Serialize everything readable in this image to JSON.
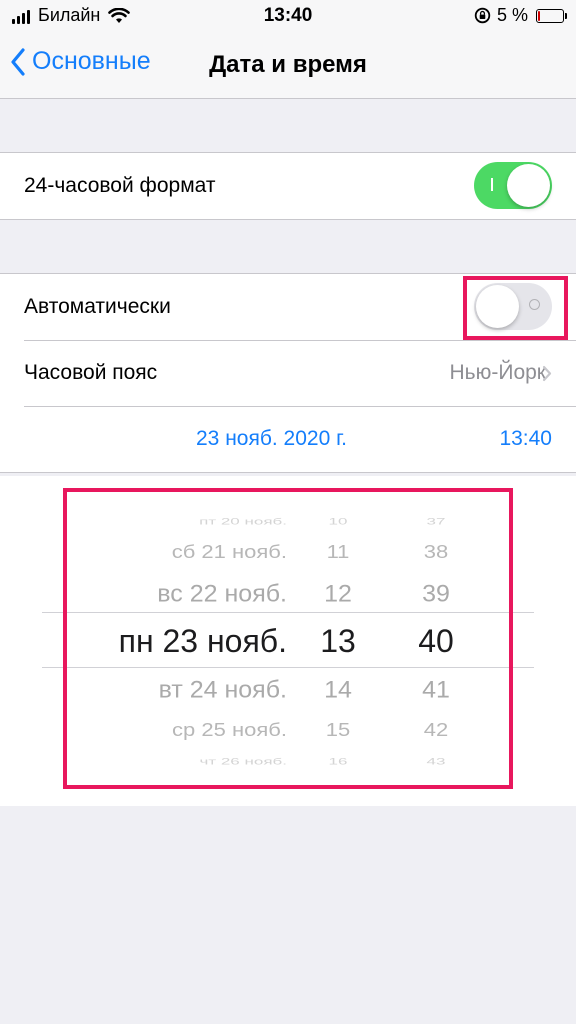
{
  "status_bar": {
    "carrier": "Билайн",
    "time": "13:40",
    "battery": "5 %"
  },
  "nav": {
    "back_label": "Основные",
    "title": "Дата и время"
  },
  "settings": {
    "format_24h": {
      "label": "24-часовой формат",
      "on": true
    },
    "automatic": {
      "label": "Автоматически",
      "on": false
    },
    "timezone": {
      "label": "Часовой пояс",
      "value": "Нью-Йорк"
    },
    "current_date": "23 нояб. 2020 г.",
    "current_time": "13:40"
  },
  "picker": {
    "dates": [
      "пт 20 нояб.",
      "сб 21 нояб.",
      "вс 22 нояб.",
      "пн 23 нояб.",
      "вт 24 нояб.",
      "ср 25 нояб.",
      "чт 26 нояб."
    ],
    "hours": [
      "10",
      "11",
      "12",
      "13",
      "14",
      "15",
      "16"
    ],
    "minutes": [
      "37",
      "38",
      "39",
      "40",
      "41",
      "42",
      "43"
    ],
    "selected_index": 3
  },
  "colors": {
    "accent": "#147efb",
    "toggle_on": "#4cd964",
    "highlight": "#e8175d"
  }
}
